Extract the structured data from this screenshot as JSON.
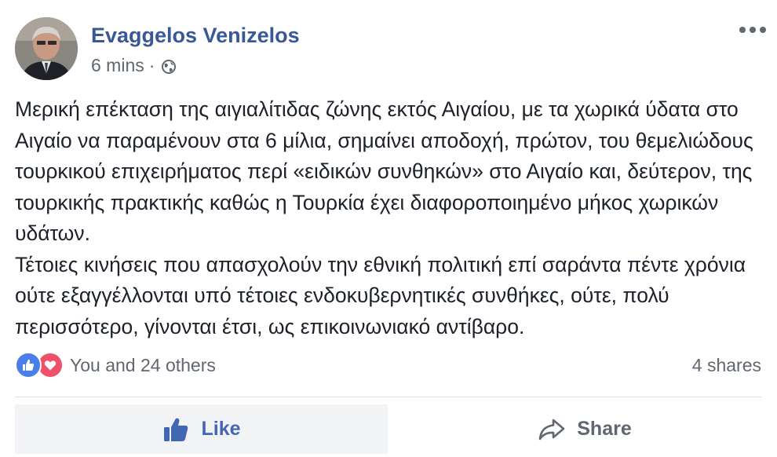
{
  "post": {
    "author": "Evaggelos Venizelos",
    "time": "6 mins",
    "separator": "·",
    "privacy_icon": "globe-icon",
    "more_icon": "more-options-icon",
    "paragraphs": [
      "Μερική επέκταση της αιγιαλίτιδας ζώνης εκτός Αιγαίου, με τα χωρικά ύδατα στο Αιγαίο να παραμένουν στα 6 μίλια, σημαίνει αποδοχή, πρώτον, του θεμελιώδους τουρκικού επιχειρήματος περί «ειδικών συνθηκών» στο Αιγαίο και, δεύτερον, της τουρκικής πρακτικής καθώς η Τουρκία έχει διαφοροποιημένο μήκος χωρικών υδάτων.",
      "Τέτοιες κινήσεις που απασχολούν την εθνική πολιτική επί σαράντα πέντε χρόνια ούτε εξαγγέλλονται υπό τέτοιες ενδοκυβερνητικές συνθήκες, ούτε, πολύ περισσότερο, γίνονται έτσι, ως επικοινωνιακό αντίβαρο."
    ]
  },
  "engagement": {
    "reactions_text": "You and 24 others",
    "shares_text": "4 shares",
    "reaction_icons": [
      "like-reaction-icon",
      "love-reaction-icon"
    ]
  },
  "actions": {
    "like_label": "Like",
    "share_label": "Share"
  },
  "colors": {
    "author": "#385898",
    "like_active": "#4267b2",
    "secondary_text": "#606770",
    "like_reaction": "#4a7ee9",
    "love_reaction": "#f0506a",
    "action_bg": "#f2f3f5"
  }
}
